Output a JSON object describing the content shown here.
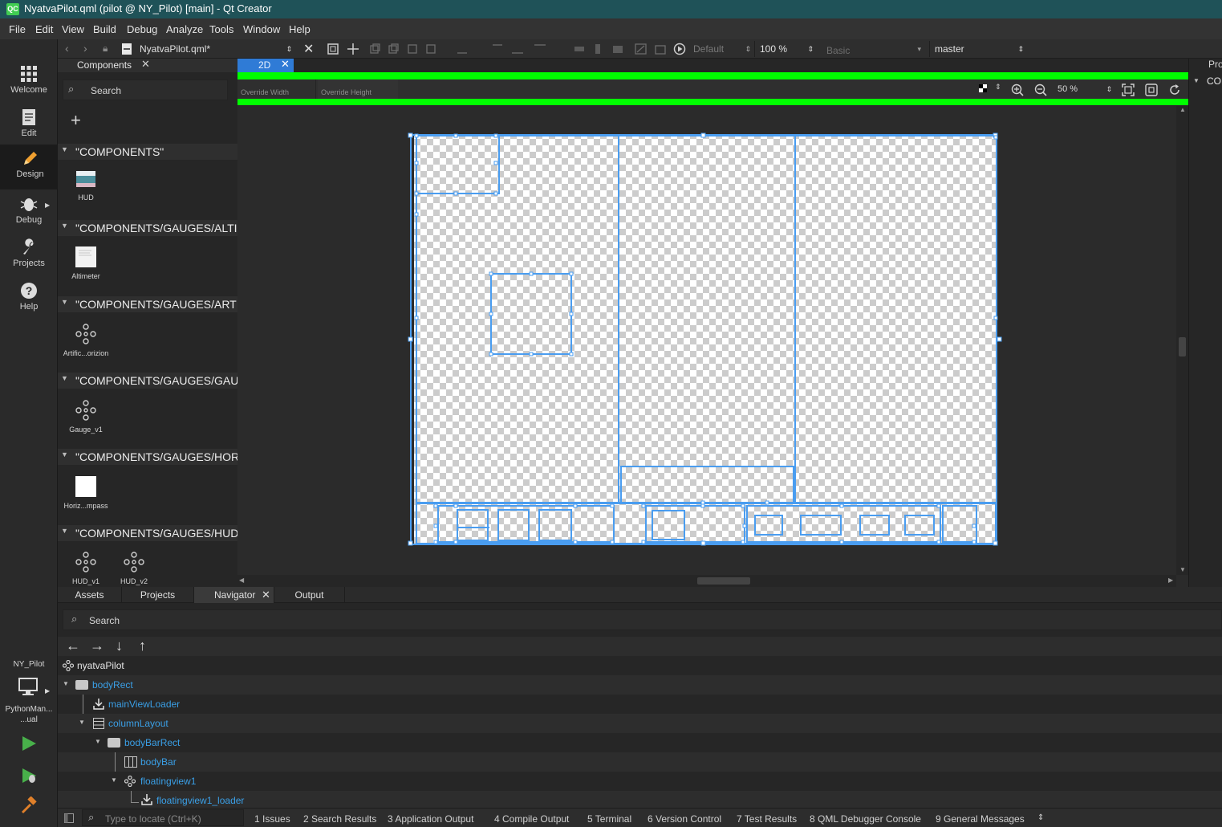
{
  "window": {
    "title": "NyatvaPilot.qml (pilot @ NY_Pilot) [main] - Qt Creator",
    "logo": "QC"
  },
  "menu": [
    "File",
    "Edit",
    "View",
    "Build",
    "Debug",
    "Analyze",
    "Tools",
    "Window",
    "Help"
  ],
  "modes": [
    {
      "label": "Welcome",
      "icon": "welcome-grid-icon"
    },
    {
      "label": "Edit",
      "icon": "edit-document-icon"
    },
    {
      "label": "Design",
      "icon": "design-pencil-icon",
      "active": true
    },
    {
      "label": "Debug",
      "icon": "debug-bug-icon"
    },
    {
      "label": "Projects",
      "icon": "projects-wrench-icon"
    },
    {
      "label": "Help",
      "icon": "help-question-icon"
    }
  ],
  "kit": {
    "project": "NY_Pilot",
    "build": "PythonMan...\n...ual"
  },
  "toolbar": {
    "file": "NyatvaPilot.qml*",
    "state": "Default",
    "zoom": "100 %",
    "style": "Basic",
    "branch": "master"
  },
  "components": {
    "panel_title": "Components",
    "search_placeholder": "Search",
    "categories": [
      {
        "name": "\"COMPONENTS\"",
        "items": [
          {
            "label": "HUD",
            "icon": "hud-thumbnail-icon"
          }
        ]
      },
      {
        "name": "\"COMPONENTS/GAUGES/ALTI",
        "items": [
          {
            "label": "Altimeter",
            "icon": "document-thumbnail-icon"
          }
        ]
      },
      {
        "name": "\"COMPONENTS/GAUGES/ARTI",
        "items": [
          {
            "label": "Artific...orizion",
            "icon": "component-nodes-icon"
          }
        ]
      },
      {
        "name": "\"COMPONENTS/GAUGES/GAU",
        "items": [
          {
            "label": "Gauge_v1",
            "icon": "component-nodes-icon"
          }
        ]
      },
      {
        "name": "\"COMPONENTS/GAUGES/HOR",
        "items": [
          {
            "label": "Horiz...mpass",
            "icon": "white-square-icon"
          }
        ]
      },
      {
        "name": "\"COMPONENTS/GAUGES/HUD",
        "items": [
          {
            "label": "HUD_v1",
            "icon": "component-nodes-icon"
          },
          {
            "label": "HUD_v2",
            "icon": "component-nodes-icon"
          }
        ]
      }
    ]
  },
  "editor": {
    "tab": "2D",
    "override_width": "Override Width",
    "override_height": "Override Height",
    "zoom": "50 %"
  },
  "right_panel": {
    "title": "Pro",
    "item": "CON"
  },
  "bottom_tabs": [
    {
      "label": "Assets"
    },
    {
      "label": "Projects"
    },
    {
      "label": "Navigator",
      "active": true
    },
    {
      "label": "Output"
    }
  ],
  "navigator": {
    "search_placeholder": "Search",
    "root": "nyatvaPilot",
    "nodes": [
      {
        "label": "bodyRect",
        "icon": "rectangle-icon"
      },
      {
        "label": "mainViewLoader",
        "icon": "loader-download-icon"
      },
      {
        "label": "columnLayout",
        "icon": "column-layout-icon"
      },
      {
        "label": "bodyBarRect",
        "icon": "rectangle-icon"
      },
      {
        "label": "bodyBar",
        "icon": "row-layout-icon"
      },
      {
        "label": "floatingview1",
        "icon": "component-nodes-icon"
      },
      {
        "label": "floatingview1_loader",
        "icon": "loader-download-icon"
      }
    ]
  },
  "status": {
    "locate_placeholder": "Type to locate (Ctrl+K)",
    "panes": [
      "1  Issues",
      "2  Search Results",
      "3  Application Output",
      "4  Compile Output",
      "5  Terminal",
      "6  Version Control",
      "7  Test Results",
      "8  QML Debugger Console",
      "9  General Messages"
    ]
  },
  "colors": {
    "accent": "#4a9df0",
    "guide": "#00ff00",
    "titlebar": "#1f5258",
    "node_text": "#3a9fe6"
  }
}
